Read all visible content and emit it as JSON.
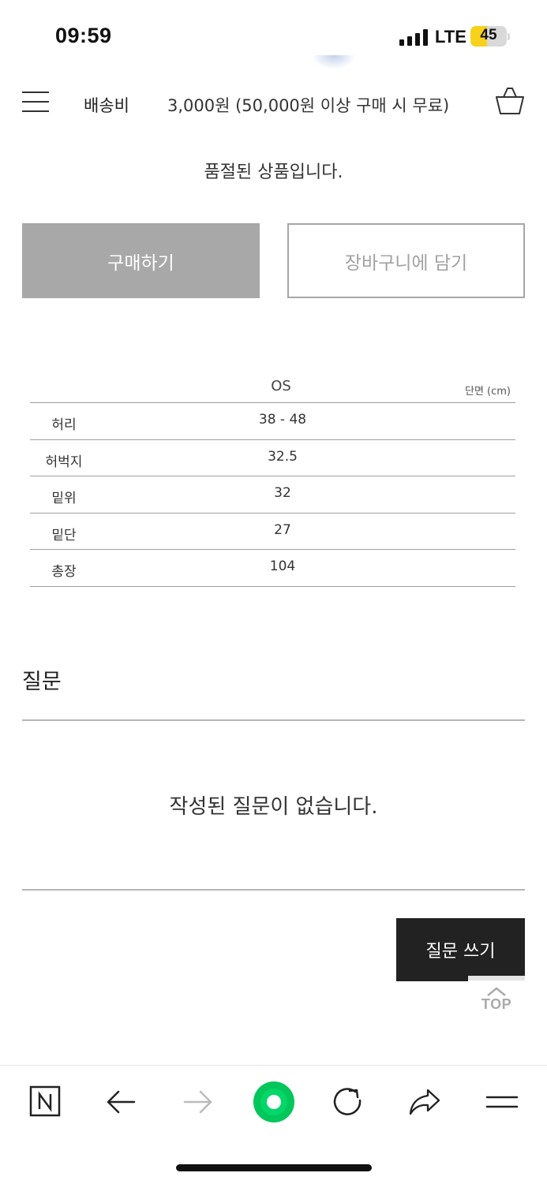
{
  "status_bar": {
    "time": "09:59",
    "network": "LTE",
    "battery": "45",
    "battery_level": 0.45,
    "battery_color": "#f7d11c"
  },
  "header": {
    "menu_icon": "hamburger-icon",
    "shipping_label": "배송비",
    "shipping_value": "3,000원 (50,000원 이상 구매 시 무료)",
    "cart_icon": "shopping-basket-icon"
  },
  "product": {
    "soldout_message": "품절된 상품입니다.",
    "buy_label": "구매하기",
    "add_to_cart_label": "장바구니에 담기"
  },
  "size_table": {
    "column_header": "OS",
    "unit_label": "단면 (cm)",
    "rows": [
      {
        "label": "허리",
        "value": "38 - 48"
      },
      {
        "label": "허벅지",
        "value": "32.5"
      },
      {
        "label": "밑위",
        "value": "32"
      },
      {
        "label": "밑단",
        "value": "27"
      },
      {
        "label": "총장",
        "value": "104"
      }
    ]
  },
  "questions": {
    "title": "질문",
    "empty_message": "작성된 질문이 없습니다.",
    "write_label": "질문 쓰기"
  },
  "scroll_top": {
    "label": "TOP"
  },
  "toolbar": {
    "items": [
      "naver-home-icon",
      "back-arrow-icon",
      "forward-arrow-icon",
      "green-dot-icon",
      "reload-icon",
      "share-icon",
      "menu-icon"
    ],
    "accent_color": "#03c75a"
  }
}
